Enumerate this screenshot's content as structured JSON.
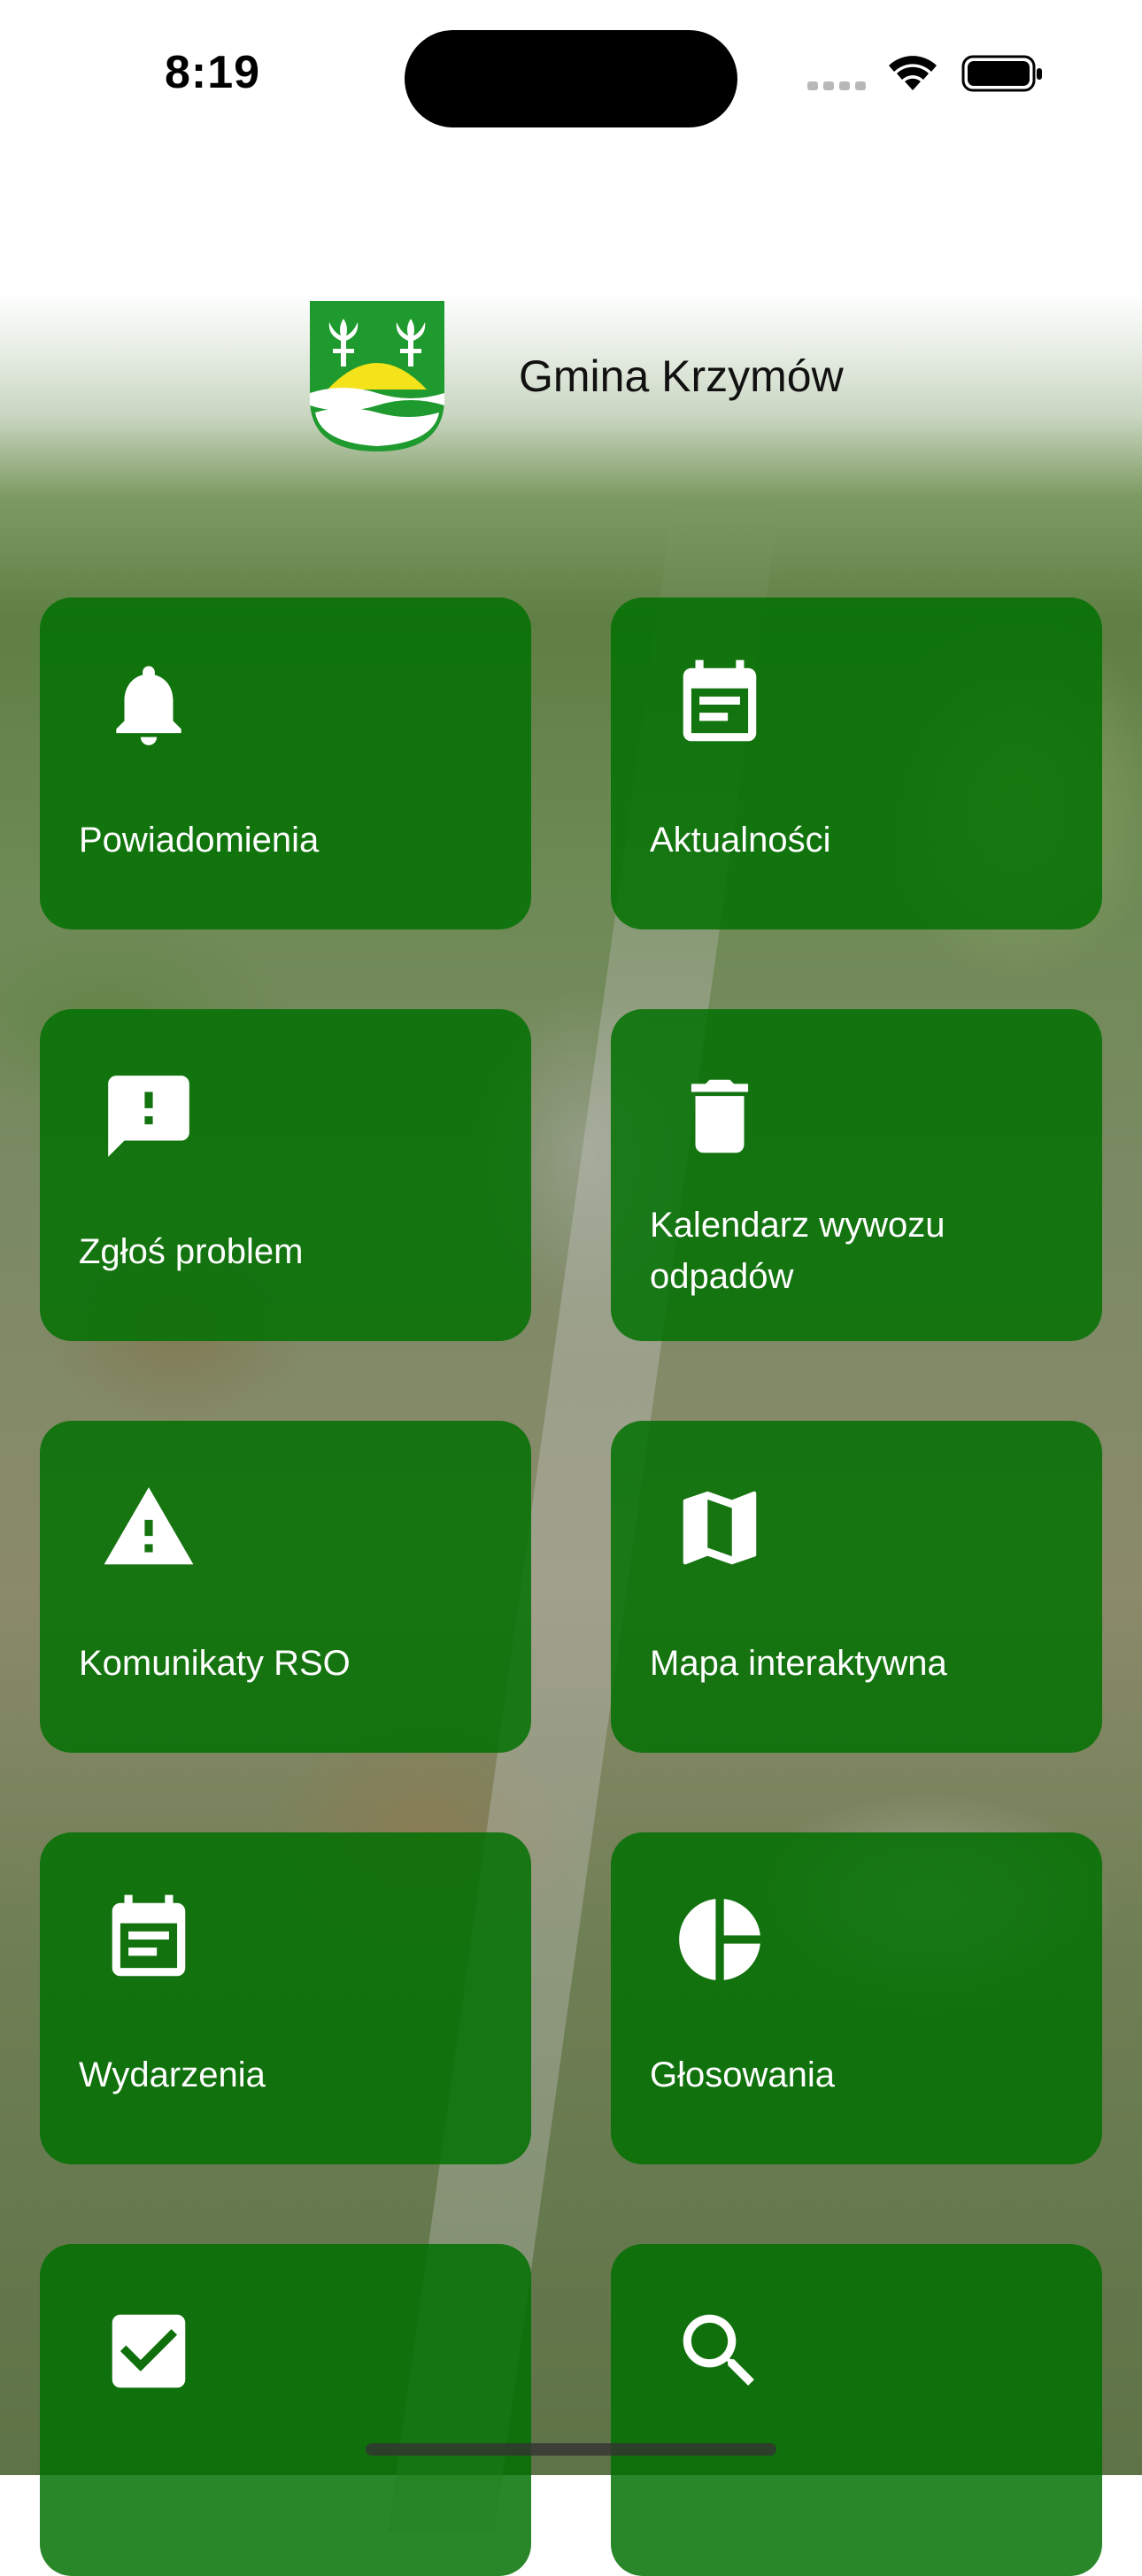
{
  "status_bar": {
    "time": "8:19"
  },
  "header": {
    "title": "Gmina Krzymów",
    "crest_icon": "coat-of-arms-icon"
  },
  "tiles": [
    {
      "label": "Powiadomienia",
      "icon": "bell-icon"
    },
    {
      "label": "Aktualności",
      "icon": "news-icon"
    },
    {
      "label": "Zgłoś problem",
      "icon": "report-problem-icon"
    },
    {
      "label": "Kalendarz wywozu odpadów",
      "icon": "trash-icon"
    },
    {
      "label": "Komunikaty RSO",
      "icon": "warning-icon"
    },
    {
      "label": "Mapa interaktywna",
      "icon": "map-icon"
    },
    {
      "label": "Wydarzenia",
      "icon": "calendar-icon"
    },
    {
      "label": "Głosowania",
      "icon": "pie-chart-icon"
    },
    {
      "label": "",
      "icon": "checkbox-icon"
    },
    {
      "label": "",
      "icon": "search-icon"
    }
  ],
  "colors": {
    "tile_green": "#007000",
    "text_white": "#ffffff"
  }
}
